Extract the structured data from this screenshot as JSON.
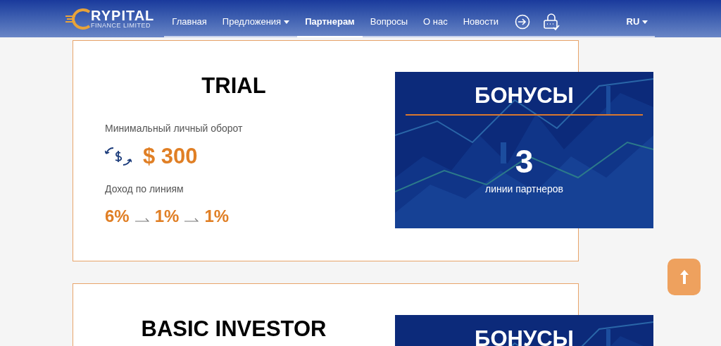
{
  "header": {
    "logo": {
      "name": "RYPITAL",
      "subtitle": "FINANCE LIMITED"
    },
    "nav": [
      {
        "label": "Главная",
        "selected": false,
        "dropdown": false
      },
      {
        "label": "Предложения",
        "selected": false,
        "dropdown": true
      },
      {
        "label": "Партнерам",
        "selected": true,
        "dropdown": false
      },
      {
        "label": "Вопросы",
        "selected": false,
        "dropdown": false
      },
      {
        "label": "О нас",
        "selected": false,
        "dropdown": false
      },
      {
        "label": "Новости",
        "selected": false,
        "dropdown": false
      }
    ],
    "language": {
      "label": "RU",
      "dropdown": true
    }
  },
  "plans": [
    {
      "title": "TRIAL",
      "turnover_label": "Минимальный личный оборот",
      "turnover": "$ 300",
      "income_label": "Доход по линиям",
      "income_rates": [
        "6%",
        "1%",
        "1%"
      ],
      "bonus": {
        "title": "БОНУСЫ",
        "count": "3",
        "count_label": "линии партнеров"
      }
    },
    {
      "title": "BASIC INVESTOR",
      "bonus": {
        "title": "БОНУСЫ"
      }
    }
  ]
}
